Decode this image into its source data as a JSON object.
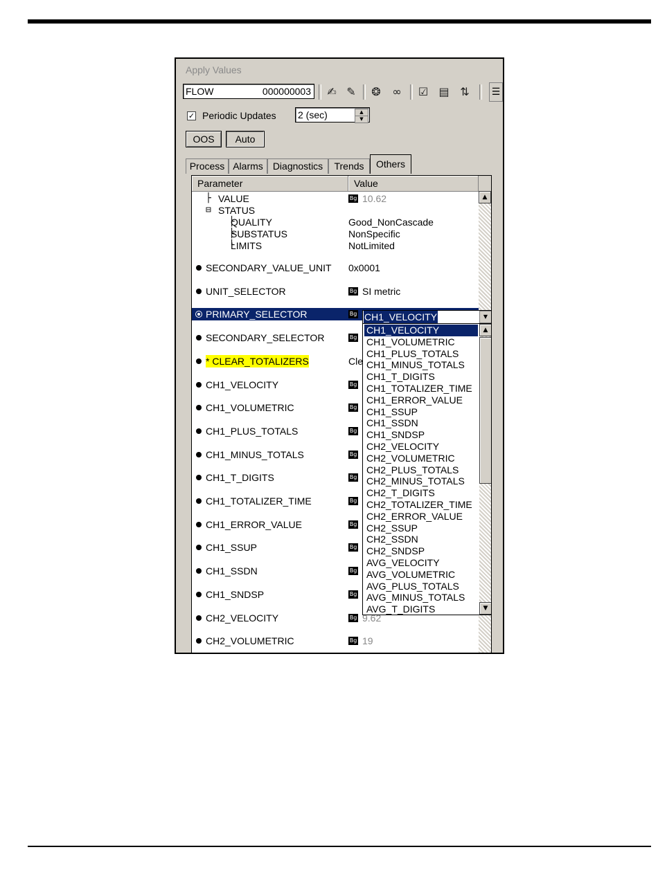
{
  "window": {
    "title": "Apply Values"
  },
  "toolbar": {
    "tag_name": "FLOW",
    "tag_id": "000000003",
    "icons": [
      "pen-icon",
      "pencil-icon",
      "brain-icon",
      "glasses-icon",
      "checklist-icon",
      "form-icon",
      "transfer-icon",
      "toolbar-grip-icon"
    ]
  },
  "periodic": {
    "label": "Periodic Updates",
    "checked": true,
    "check_glyph": "✓",
    "interval": "2 (sec)"
  },
  "mode_buttons": {
    "oos": "OOS",
    "auto": "Auto"
  },
  "tabs": [
    "Process",
    "Alarms",
    "Diagnostics",
    "Trends",
    "Others"
  ],
  "active_tab": "Others",
  "grid": {
    "headers": {
      "parameter": "Parameter",
      "value": "Value"
    },
    "subtree": [
      {
        "tree": "├",
        "name": "VALUE",
        "value": "10.62",
        "grey": true,
        "icon": true
      },
      {
        "tree": "⊟",
        "name": "STATUS",
        "value": ""
      },
      {
        "tree": "  ├",
        "name": "QUALITY",
        "value": "Good_NonCascade"
      },
      {
        "tree": "  ├",
        "name": "SUBSTATUS",
        "value": "NonSpecific"
      },
      {
        "tree": "  └",
        "name": "LIMITS",
        "value": "NotLimited"
      }
    ],
    "rows": [
      {
        "name": "SECONDARY_VALUE_UNIT",
        "value": "0x0001",
        "icon": false
      },
      {
        "name": "UNIT_SELECTOR",
        "value": "SI metric",
        "icon": true
      },
      {
        "name": "PRIMARY_SELECTOR",
        "value": "",
        "icon": true,
        "selected": true
      },
      {
        "name": "SECONDARY_SELECTOR",
        "value": "",
        "icon": true
      },
      {
        "name": "* CLEAR_TOTALIZERS",
        "value": "Cle",
        "icon": false,
        "highlight": true
      },
      {
        "name": "CH1_VELOCITY",
        "value": "",
        "icon": true
      },
      {
        "name": "CH1_VOLUMETRIC",
        "value": "",
        "icon": true
      },
      {
        "name": "CH1_PLUS_TOTALS",
        "value": "",
        "icon": true
      },
      {
        "name": "CH1_MINUS_TOTALS",
        "value": "",
        "icon": true
      },
      {
        "name": "CH1_T_DIGITS",
        "value": "",
        "icon": true
      },
      {
        "name": "CH1_TOTALIZER_TIME",
        "value": "",
        "icon": true
      },
      {
        "name": "CH1_ERROR_VALUE",
        "value": "",
        "icon": true
      },
      {
        "name": "CH1_SSUP",
        "value": "",
        "icon": true
      },
      {
        "name": "CH1_SSDN",
        "value": "",
        "icon": true
      },
      {
        "name": "CH1_SNDSP",
        "value": "",
        "icon": true
      },
      {
        "name": "CH2_VELOCITY",
        "value": "9.62",
        "icon": true,
        "grey": true
      },
      {
        "name": "CH2_VOLUMETRIC",
        "value": "19",
        "icon": true,
        "grey": true
      }
    ]
  },
  "combo": {
    "value": "CH1_VELOCITY",
    "options": [
      "CH1_VELOCITY",
      "CH1_VOLUMETRIC",
      "CH1_PLUS_TOTALS",
      "CH1_MINUS_TOTALS",
      "CH1_T_DIGITS",
      "CH1_TOTALIZER_TIME",
      "CH1_ERROR_VALUE",
      "CH1_SSUP",
      "CH1_SSDN",
      "CH1_SNDSP",
      "CH2_VELOCITY",
      "CH2_VOLUMETRIC",
      "CH2_PLUS_TOTALS",
      "CH2_MINUS_TOTALS",
      "CH2_T_DIGITS",
      "CH2_TOTALIZER_TIME",
      "CH2_ERROR_VALUE",
      "CH2_SSUP",
      "CH2_SSDN",
      "CH2_SNDSP",
      "AVG_VELOCITY",
      "AVG_VOLUMETRIC",
      "AVG_PLUS_TOTALS",
      "AVG_MINUS_TOTALS",
      "AVG_T_DIGITS"
    ],
    "selected_index": 0
  },
  "colors": {
    "selection": "#0a246a",
    "highlight": "#ffff00",
    "face": "#d4d0c8"
  }
}
